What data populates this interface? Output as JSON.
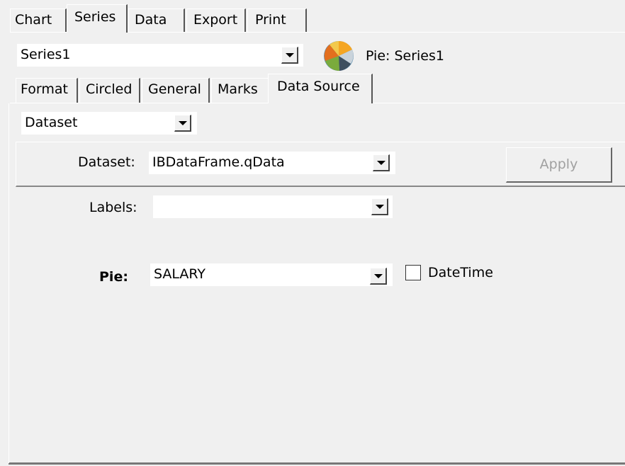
{
  "main_tabs": [
    "Chart",
    "Series",
    "Data",
    "Export",
    "Print"
  ],
  "series_select": {
    "value": "Series1"
  },
  "series_info": {
    "label": "Pie: Series1",
    "icon": "pie-chart-icon"
  },
  "sub_tabs": [
    "Format",
    "Circled",
    "General",
    "Marks",
    "Data Source"
  ],
  "source_type": {
    "value": "Dataset"
  },
  "dataset": {
    "label": "Dataset:",
    "value": "IBDataFrame.qData",
    "apply_label": "Apply"
  },
  "labels": {
    "label": "Labels:",
    "value": ""
  },
  "pie": {
    "label": "Pie:",
    "value": "SALARY",
    "datetime_label": "DateTime"
  }
}
